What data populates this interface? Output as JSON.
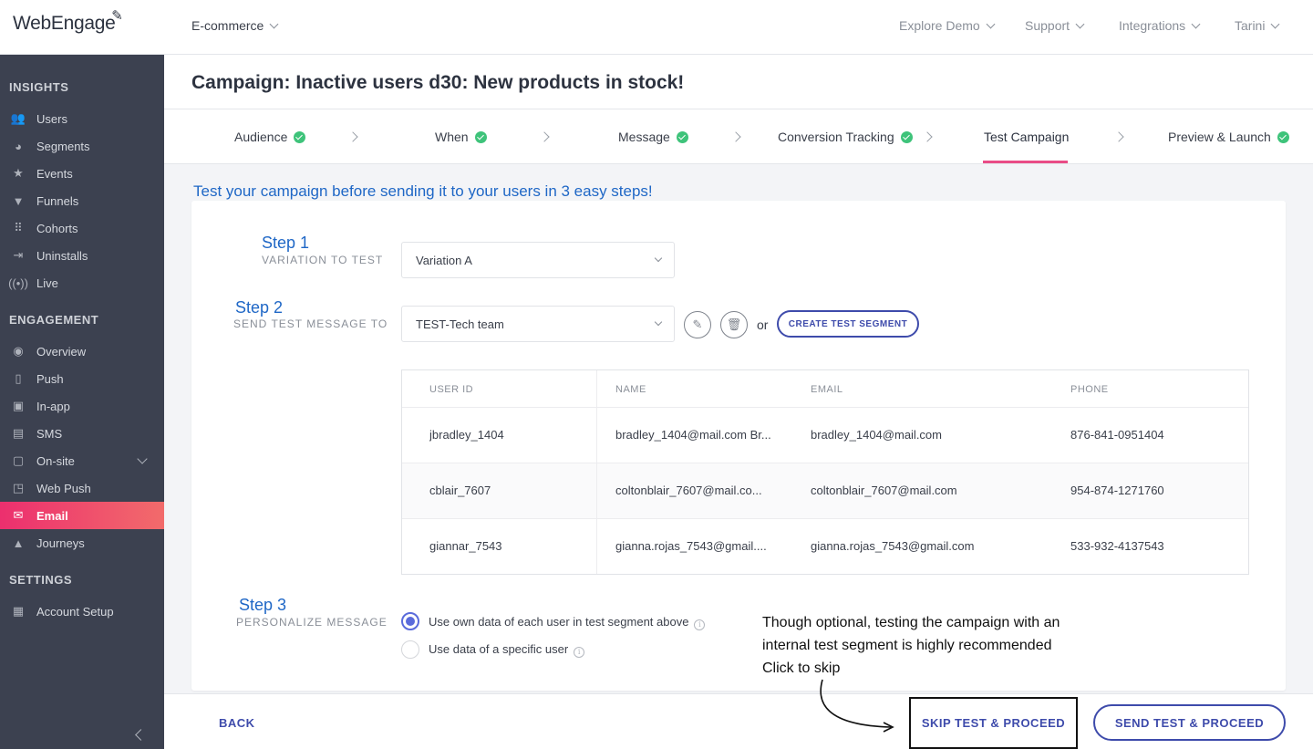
{
  "header": {
    "logo_text": "WebEngage",
    "project": "E-commerce",
    "nav": [
      "Explore Demo",
      "Support",
      "Integrations",
      "Tarini"
    ]
  },
  "sidebar": {
    "sections": [
      {
        "title": "INSIGHTS",
        "items": [
          {
            "label": "Users",
            "icon": "users-icon"
          },
          {
            "label": "Segments",
            "icon": "pie-icon"
          },
          {
            "label": "Events",
            "icon": "star-icon"
          },
          {
            "label": "Funnels",
            "icon": "funnel-icon"
          },
          {
            "label": "Cohorts",
            "icon": "grid-icon"
          },
          {
            "label": "Uninstalls",
            "icon": "uninstall-icon"
          },
          {
            "label": "Live",
            "icon": "broadcast-icon"
          }
        ]
      },
      {
        "title": "ENGAGEMENT",
        "items": [
          {
            "label": "Overview",
            "icon": "eye-icon"
          },
          {
            "label": "Push",
            "icon": "mobile-icon"
          },
          {
            "label": "In-app",
            "icon": "mobile-inapp-icon"
          },
          {
            "label": "SMS",
            "icon": "chat-icon"
          },
          {
            "label": "On-site",
            "icon": "window-icon"
          },
          {
            "label": "Web Push",
            "icon": "webpush-icon"
          },
          {
            "label": "Email",
            "icon": "mail-icon",
            "active": true
          },
          {
            "label": "Journeys",
            "icon": "rocket-icon"
          }
        ]
      },
      {
        "title": "SETTINGS",
        "items": [
          {
            "label": "Account Setup",
            "icon": "dashboard-icon"
          }
        ]
      }
    ]
  },
  "page": {
    "title": "Campaign: Inactive users d30: New products in stock!"
  },
  "steps": [
    {
      "label": "Audience",
      "done": true
    },
    {
      "label": "When",
      "done": true
    },
    {
      "label": "Message",
      "done": true
    },
    {
      "label": "Conversion Tracking",
      "done": true
    },
    {
      "label": "Test Campaign",
      "done": false,
      "active": true
    },
    {
      "label": "Preview & Launch",
      "done": true
    }
  ],
  "intro": "Test your campaign before sending it to your users in 3 easy steps!",
  "step1": {
    "title": "Step 1",
    "subtitle": "VARIATION TO TEST",
    "value": "Variation A"
  },
  "step2": {
    "title": "Step 2",
    "subtitle": "SEND TEST MESSAGE TO",
    "value": "TEST-Tech team",
    "or": "or",
    "create_label": "CREATE TEST SEGMENT"
  },
  "table": {
    "headers": [
      "USER ID",
      "NAME",
      "EMAIL",
      "PHONE"
    ],
    "rows": [
      [
        "jbradley_1404",
        "bradley_1404@mail.com Br...",
        "bradley_1404@mail.com",
        "876-841-0951404"
      ],
      [
        "cblair_7607",
        "coltonblair_7607@mail.co...",
        "coltonblair_7607@mail.com",
        "954-874-1271760"
      ],
      [
        "giannar_7543",
        "gianna.rojas_7543@gmail....",
        "gianna.rojas_7543@gmail.com",
        "533-932-4137543"
      ]
    ]
  },
  "step3": {
    "title": "Step 3",
    "subtitle": "PERSONALIZE MESSAGE",
    "options": [
      {
        "label": "Use own data of each user in test segment above",
        "selected": true
      },
      {
        "label": "Use data of a specific user",
        "selected": false
      }
    ]
  },
  "annotation": {
    "lines": [
      "Though optional, testing the campaign with an",
      "internal test segment is highly recommended",
      "Click to skip"
    ]
  },
  "footer": {
    "back": "BACK",
    "skip": "SKIP TEST & PROCEED",
    "send": "SEND TEST & PROCEED"
  },
  "colors": {
    "accent": "#3e4bab",
    "step_blue": "#1f67c6",
    "active_gradient_start": "#ec2f6e",
    "active_gradient_end": "#f26b6b",
    "success": "#3ec37a",
    "sidebar_bg": "#3c4150"
  }
}
